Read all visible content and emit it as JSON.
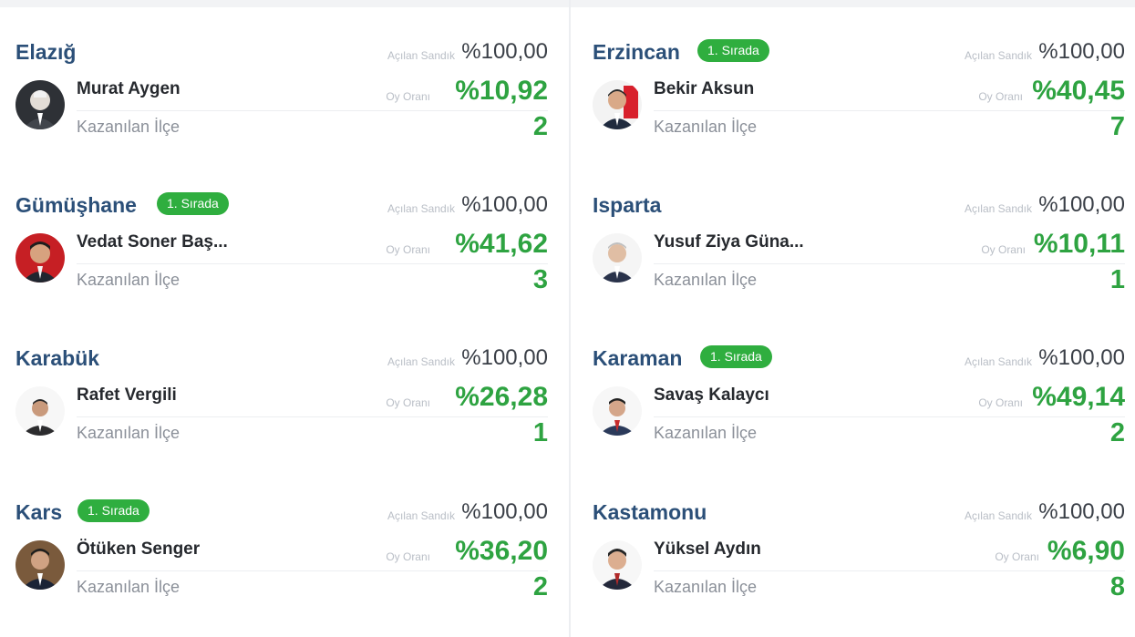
{
  "labels": {
    "opened_boxes": "Açılan Sandık",
    "vote_rate": "Oy Oranı",
    "districts_won": "Kazanılan İlçe"
  },
  "colors": {
    "city_blue": "#2b4f78",
    "accent_green": "#2ea341",
    "badge_green": "#2fae3f"
  },
  "provinces": [
    {
      "city": "Elazığ",
      "badge": "",
      "opened": "%100,00",
      "candidate": "Murat Aygen",
      "vote": "%10,92",
      "districts": "2",
      "avatar_icon": "person-photo-icon"
    },
    {
      "city": "Erzincan",
      "badge": "1. Sırada",
      "opened": "%100,00",
      "candidate": "Bekir Aksun",
      "vote": "%40,45",
      "districts": "7",
      "avatar_icon": "person-photo-icon"
    },
    {
      "city": "Gümüşhane",
      "badge": "1. Sırada",
      "opened": "%100,00",
      "candidate": "Vedat Soner Baş...",
      "vote": "%41,62",
      "districts": "3",
      "avatar_icon": "person-photo-icon"
    },
    {
      "city": "Isparta",
      "badge": "",
      "opened": "%100,00",
      "candidate": "Yusuf Ziya Güna...",
      "vote": "%10,11",
      "districts": "1",
      "avatar_icon": "person-photo-icon"
    },
    {
      "city": "Karabük",
      "badge": "",
      "opened": "%100,00",
      "candidate": "Rafet Vergili",
      "vote": "%26,28",
      "districts": "1",
      "avatar_icon": "person-photo-icon"
    },
    {
      "city": "Karaman",
      "badge": "1. Sırada",
      "opened": "%100,00",
      "candidate": "Savaş Kalaycı",
      "vote": "%49,14",
      "districts": "2",
      "avatar_icon": "person-photo-icon"
    },
    {
      "city": "Kars",
      "badge": "1. Sırada",
      "opened": "%100,00",
      "candidate": "Ötüken Senger",
      "vote": "%36,20",
      "districts": "2",
      "avatar_icon": "person-photo-icon"
    },
    {
      "city": "Kastamonu",
      "badge": "",
      "opened": "%100,00",
      "candidate": "Yüksel Aydın",
      "vote": "%6,90",
      "districts": "8",
      "avatar_icon": "person-photo-icon"
    }
  ]
}
